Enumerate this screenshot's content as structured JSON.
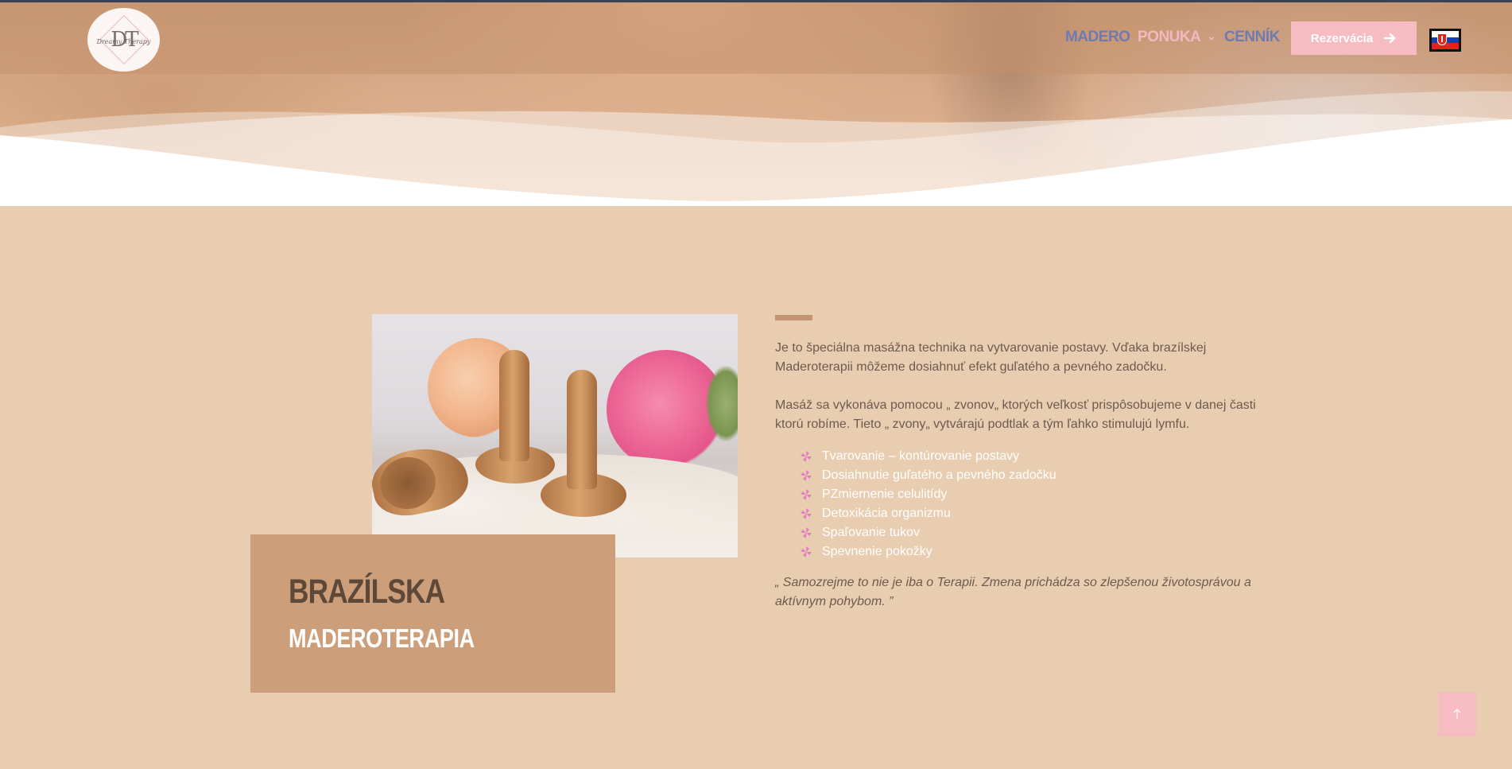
{
  "header": {
    "logo": {
      "monogram": "DT",
      "text": "Dreamy Therapy"
    },
    "nav": [
      {
        "label": "MADERO"
      },
      {
        "label": "PONUKA"
      },
      {
        "label": "CENNÍK"
      }
    ],
    "reservation_label": "Rezervácia",
    "language_flag": "slovakia-flag"
  },
  "section": {
    "title_line1": "BRAZÍLSKA",
    "title_line2": "MADEROTERAPIA",
    "paragraph1": "Je to špeciálna masážna technika na vytvarovanie postavy. Vďaka brazílskej Maderoterapii môžeme dosiahnuť efekt guľatého a pevného zadočku.",
    "paragraph2": "Masáž sa vykonáva pomocou „ zvonov„ ktorých veľkosť prispôsobujeme v danej časti ktorú robíme. Tieto „ zvony„ vytvárajú podtlak a tým ľahko stimulujú lymfu.",
    "features": [
      "Tvarovanie – kontúrovanie postavy",
      "Dosiahnutie guľatého a pevného zadočku",
      "PZmiernenie celulitídy",
      "Detoxikácia organizmu",
      "Spaľovanie tukov",
      "Spevnenie pokožky"
    ],
    "quote": "„ Samozrejme to nie je iba o Terapii. Zmena prichádza so zlepšenou životosprávou a aktívnym pohybom. ”"
  },
  "scroll_top_icon": "arrow-up-icon",
  "colors": {
    "page_bg": "#e8cdb1",
    "accent_pink": "#f7bcc1",
    "nav_blue": "#6f7bb0",
    "title_box": "#cd9e7a",
    "list_icon": "#e57fb9"
  }
}
